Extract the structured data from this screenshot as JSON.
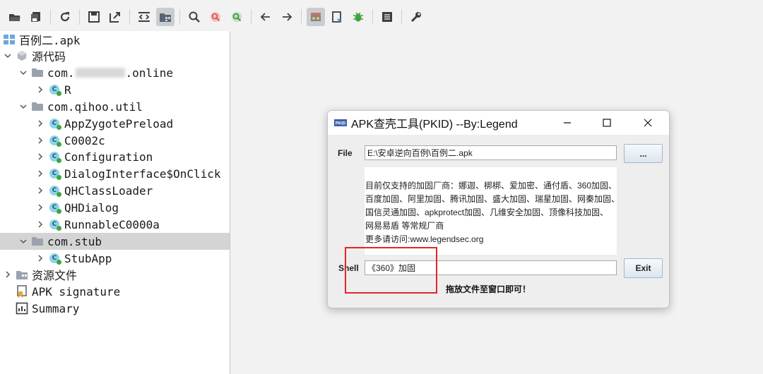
{
  "toolbar": {
    "icons": [
      "open-file-icon",
      "save-all-icon",
      "reload-icon",
      "save-icon",
      "export-icon",
      "sync-code-icon",
      "flatten-packages-icon",
      "search-icon",
      "search-class-icon",
      "search-usage-icon",
      "back-icon",
      "forward-icon",
      "deobfuscation-icon",
      "quark-icon",
      "debug-icon",
      "log-icon",
      "preferences-icon"
    ]
  },
  "tree": {
    "root": "百例二.apk",
    "source_folder": "源代码",
    "pkg1_prefix": "com.",
    "pkg1_suffix": ".online",
    "pkg1_children": [
      "R"
    ],
    "pkg2": "com.qihoo.util",
    "pkg2_children": [
      "AppZygotePreload",
      "C0002c",
      "Configuration",
      "DialogInterface$OnClick",
      "QHClassLoader",
      "QHDialog",
      "RunnableC0000a"
    ],
    "pkg3": "com.stub",
    "pkg3_children": [
      "StubApp"
    ],
    "resources": "资源文件",
    "signature": "APK signature",
    "summary": "Summary"
  },
  "dialog": {
    "title": "APK查壳工具(PKID) --By:Legend",
    "app_icon_text": "PKID",
    "file_label": "File",
    "file_value": "E:\\安卓逆向百例\\百例二.apk",
    "browse_label": "...",
    "info_lines": [
      "目前仅支持的加固厂商：娜迦、梆梆、爱加密、通付盾、360加固、",
      "百度加固、阿里加固、腾讯加固、盛大加固、瑞星加固、网秦加固、",
      "国信灵通加固、apkprotect加固、几维安全加固、顶像科技加固、",
      "网易易盾 等常规厂商",
      "更多请访问:www.legendsec.org"
    ],
    "shell_label": "Shell",
    "shell_value": "《360》加固",
    "exit_label": "Exit",
    "hint": "拖放文件至窗口即可！"
  },
  "colors": {
    "highlight": "#e3242b",
    "selected_row": "#d4d4d4",
    "class_icon": "#8fd2ea"
  }
}
